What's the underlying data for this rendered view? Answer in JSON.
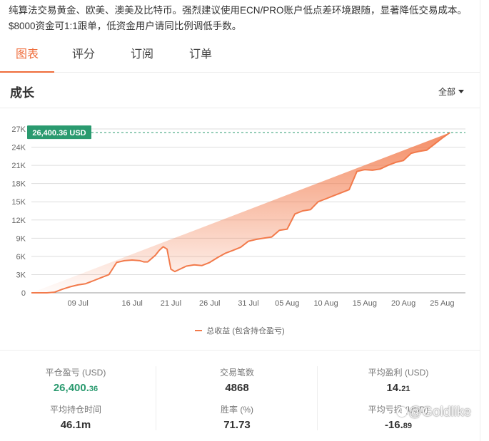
{
  "description": "纯算法交易黄金、欧美、澳美及比特币。强烈建议使用ECN/PRO账户低点差环境跟随，显著降低交易成本。$8000资金可1:1跟单，低资金用户请同比例调低手数。",
  "tabs": [
    {
      "label": "图表",
      "active": true
    },
    {
      "label": "评分",
      "active": false
    },
    {
      "label": "订阅",
      "active": false
    },
    {
      "label": "订单",
      "active": false
    }
  ],
  "growth": {
    "title": "成长",
    "range_label": "全部"
  },
  "chart_data": {
    "type": "area",
    "title": "",
    "xlabel": "",
    "ylabel": "",
    "ylim": [
      0,
      27000
    ],
    "yticks": [
      "0",
      "3K",
      "6K",
      "9K",
      "12K",
      "15K",
      "18K",
      "21K",
      "24K",
      "27K"
    ],
    "ytick_values": [
      0,
      3000,
      6000,
      9000,
      12000,
      15000,
      18000,
      21000,
      24000,
      27000
    ],
    "xticks": [
      "09 Jul",
      "16 Jul",
      "21 Jul",
      "26 Jul",
      "31 Jul",
      "05 Aug",
      "10 Aug",
      "15 Aug",
      "20 Aug",
      "25 Aug"
    ],
    "xtick_days": [
      9,
      16,
      21,
      26,
      31,
      36,
      41,
      46,
      51,
      56
    ],
    "x_day": [
      3,
      5,
      6,
      7,
      8,
      9,
      10,
      11,
      12,
      13,
      14,
      15,
      16,
      17,
      17.5,
      18,
      19,
      19.5,
      20,
      20.5,
      21,
      21.5,
      22,
      23,
      24,
      25,
      26,
      27,
      28,
      29,
      30,
      31,
      32,
      33,
      34,
      35,
      36,
      37,
      38,
      39,
      40,
      41,
      42,
      43,
      44,
      45,
      46,
      47,
      48,
      49,
      50,
      51,
      52,
      53,
      54,
      55,
      56,
      57,
      58,
      59
    ],
    "series": [
      {
        "name": "总收益 (包含持仓盈亏)",
        "values": [
          0,
          0,
          100,
          600,
          1000,
          1300,
          1500,
          2000,
          2500,
          3000,
          5000,
          5300,
          5400,
          5300,
          5100,
          5100,
          6200,
          7000,
          7600,
          7200,
          3900,
          3500,
          3800,
          4400,
          4600,
          4500,
          5000,
          5800,
          6500,
          7000,
          7500,
          8500,
          8800,
          9000,
          9200,
          10300,
          10500,
          13000,
          13500,
          13700,
          15000,
          15500,
          16000,
          16500,
          17000,
          20000,
          20300,
          20200,
          20400,
          21000,
          21500,
          21800,
          23000,
          23300,
          23500,
          24500,
          25500,
          26400
        ]
      }
    ],
    "current_value_label": "26,400.36 USD",
    "current_value": 26400.36,
    "line_color": "#f27a4b",
    "label_color": "#2a9a6f",
    "grid": true,
    "legend_position": "bottom-center"
  },
  "legend_label": "总收益 (包含持仓盈亏)",
  "stats": {
    "closed_pl_label": "平仓盈亏 (USD)",
    "closed_pl_int": "26,400.",
    "closed_pl_frac": "36",
    "trades_label": "交易笔数",
    "trades_value": "4868",
    "avg_profit_label": "平均盈利 (USD)",
    "avg_profit_int": "14.",
    "avg_profit_frac": "21",
    "avg_hold_label": "平均持仓时间",
    "avg_hold_value": "46.1m",
    "winrate_label": "胜率 (%)",
    "winrate_value": "71.73",
    "avg_loss_label": "平均亏损 (USD)",
    "avg_loss_int": "-16.",
    "avg_loss_frac": "89"
  },
  "watermark": "@Goldlike"
}
